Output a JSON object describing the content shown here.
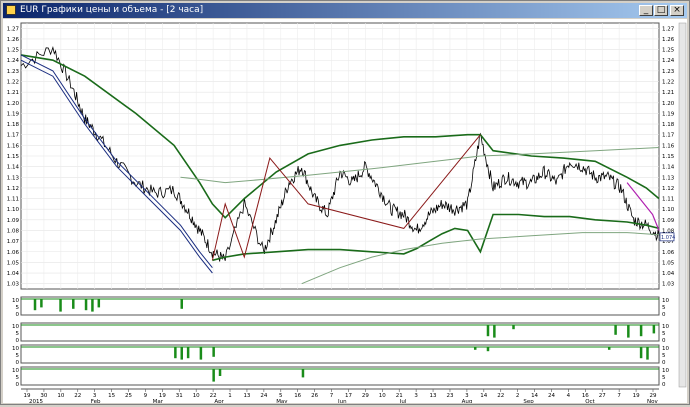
{
  "window": {
    "title": "EUR Графики цены и объема - [2 часа]",
    "buttons": [
      "_",
      "□",
      "×"
    ]
  },
  "chart_data": [
    {
      "type": "line",
      "title": "",
      "ylabel": "",
      "ylim": [
        1.025,
        1.275
      ],
      "y_ticks": [
        "1.27",
        "1.26",
        "1.25",
        "1.24",
        "1.23",
        "1.22",
        "1.21",
        "1.20",
        "1.19",
        "1.18",
        "1.17",
        "1.16",
        "1.15",
        "1.14",
        "1.13",
        "1.12",
        "1.11",
        "1.10",
        "1.09",
        "1.08",
        "1.07",
        "1.06",
        "1.05",
        "1.04",
        "1.03"
      ],
      "last_price_label": "1.074",
      "grid": true,
      "series": [
        {
          "role": "price",
          "color": "#000000",
          "t": [
            0,
            5,
            8,
            10,
            12,
            15,
            18,
            21,
            24,
            26,
            28,
            30,
            32,
            35,
            38,
            40,
            42,
            44,
            46,
            48,
            50,
            52,
            54,
            56,
            58,
            60,
            62,
            64,
            66,
            68,
            70,
            72,
            74,
            76,
            78,
            80,
            82,
            84,
            86,
            88,
            90,
            92,
            94,
            96,
            98,
            100
          ],
          "values": [
            1.235,
            1.252,
            1.215,
            1.185,
            1.17,
            1.145,
            1.125,
            1.115,
            1.118,
            1.1,
            1.08,
            1.06,
            1.052,
            1.105,
            1.06,
            1.09,
            1.125,
            1.14,
            1.11,
            1.095,
            1.135,
            1.125,
            1.14,
            1.12,
            1.1,
            1.095,
            1.08,
            1.095,
            1.105,
            1.1,
            1.105,
            1.17,
            1.12,
            1.13,
            1.125,
            1.125,
            1.135,
            1.125,
            1.145,
            1.14,
            1.13,
            1.13,
            1.12,
            1.09,
            1.085,
            1.075
          ]
        },
        {
          "role": "upper-band",
          "color": "#1a6b1a",
          "t": [
            0,
            5,
            10,
            18,
            24,
            28,
            30,
            32,
            35,
            40,
            45,
            50,
            55,
            60,
            65,
            70,
            72,
            74,
            80,
            85,
            90,
            95,
            98,
            100
          ],
          "values": [
            1.245,
            1.24,
            1.225,
            1.19,
            1.16,
            1.125,
            1.105,
            1.092,
            1.11,
            1.135,
            1.152,
            1.16,
            1.165,
            1.168,
            1.168,
            1.17,
            1.17,
            1.155,
            1.15,
            1.148,
            1.145,
            1.13,
            1.12,
            1.11
          ]
        },
        {
          "role": "lower-band",
          "color": "#1a6b1a",
          "t": [
            30,
            32,
            35,
            40,
            45,
            50,
            55,
            60,
            62,
            64,
            66,
            68,
            70,
            72,
            74,
            78,
            82,
            86,
            90,
            95,
            98,
            100
          ],
          "values": [
            1.052,
            1.055,
            1.058,
            1.06,
            1.062,
            1.062,
            1.06,
            1.058,
            1.063,
            1.07,
            1.077,
            1.082,
            1.08,
            1.06,
            1.095,
            1.095,
            1.093,
            1.093,
            1.09,
            1.088,
            1.085,
            1.082
          ]
        },
        {
          "role": "mid-band",
          "color": "#7fa57f",
          "t": [
            25,
            28,
            32,
            38,
            45,
            55,
            65,
            72,
            80,
            90,
            100
          ],
          "values": [
            1.13,
            1.128,
            1.125,
            1.128,
            1.132,
            1.138,
            1.145,
            1.15,
            1.152,
            1.155,
            1.158
          ]
        },
        {
          "role": "outer-lower-band",
          "color": "#7fa57f",
          "t": [
            44,
            50,
            55,
            60,
            66,
            72,
            80,
            88,
            95,
            100
          ],
          "values": [
            1.03,
            1.045,
            1.055,
            1.062,
            1.068,
            1.072,
            1.075,
            1.078,
            1.078,
            1.076
          ]
        },
        {
          "role": "down-channel",
          "color": "#1a2d80",
          "t": [
            0,
            5,
            10,
            15,
            20,
            25,
            28,
            30
          ],
          "values": [
            1.245,
            1.23,
            1.185,
            1.145,
            1.115,
            1.085,
            1.06,
            1.045
          ]
        },
        {
          "role": "down-channel-2",
          "color": "#1a2d80",
          "t": [
            0,
            5,
            10,
            15,
            20,
            25,
            28,
            30
          ],
          "values": [
            1.24,
            1.225,
            1.18,
            1.14,
            1.11,
            1.08,
            1.055,
            1.04
          ]
        },
        {
          "role": "zigzag",
          "color": "#8b1a1a",
          "t": [
            30,
            32,
            35,
            39,
            45,
            60,
            72
          ],
          "values": [
            1.052,
            1.105,
            1.055,
            1.148,
            1.105,
            1.082,
            1.17
          ]
        },
        {
          "role": "end-channel",
          "color": "#b020b0",
          "t": [
            95,
            97,
            99,
            100
          ],
          "values": [
            1.125,
            1.11,
            1.095,
            1.08
          ]
        }
      ]
    },
    {
      "type": "bar",
      "role": "indicator-1",
      "color": "#1a8c1a",
      "y_ticks": [
        "10",
        "5",
        "0"
      ],
      "values_t": [
        2,
        3,
        6,
        8,
        10,
        11,
        12,
        25
      ],
      "values": [
        8,
        6,
        9,
        7,
        8,
        9,
        6,
        7
      ]
    },
    {
      "type": "bar",
      "role": "indicator-2",
      "color": "#1a8c1a",
      "y_ticks": [
        "10",
        "5",
        "0"
      ],
      "values_t": [
        73,
        74,
        77,
        93,
        95,
        97,
        99
      ],
      "values": [
        8,
        9,
        3,
        7,
        9,
        8,
        6
      ]
    },
    {
      "type": "bar",
      "role": "indicator-3",
      "color": "#1a8c1a",
      "y_ticks": [
        "10",
        "5",
        "0"
      ],
      "values_t": [
        24,
        25,
        26,
        28,
        30,
        71,
        73,
        92,
        97,
        98
      ],
      "values": [
        8,
        9,
        8,
        9,
        7,
        2,
        3,
        2,
        8,
        9
      ]
    },
    {
      "type": "bar",
      "role": "indicator-4",
      "color": "#1a8c1a",
      "y_ticks": [
        "10",
        "5",
        "0"
      ],
      "values_t": [
        30,
        31,
        44
      ],
      "values": [
        9,
        5,
        6
      ]
    }
  ],
  "x_axis": {
    "day_labels": [
      "19",
      "30",
      "10",
      "22",
      "3",
      "15",
      "25",
      "9",
      "19",
      "31",
      "10",
      "22",
      "1",
      "13",
      "24",
      "5",
      "16",
      "26",
      "7",
      "17",
      "29",
      "10",
      "21",
      "3",
      "13",
      "23",
      "3",
      "14",
      "22",
      "2",
      "14",
      "24",
      "4",
      "16",
      "27",
      "7",
      "19",
      "29"
    ],
    "month_labels": [
      "2015",
      "Feb",
      "Mar",
      "Apr",
      "May",
      "Jun",
      "Jul",
      "Aug",
      "Sep",
      "Oct",
      "Nov"
    ]
  }
}
